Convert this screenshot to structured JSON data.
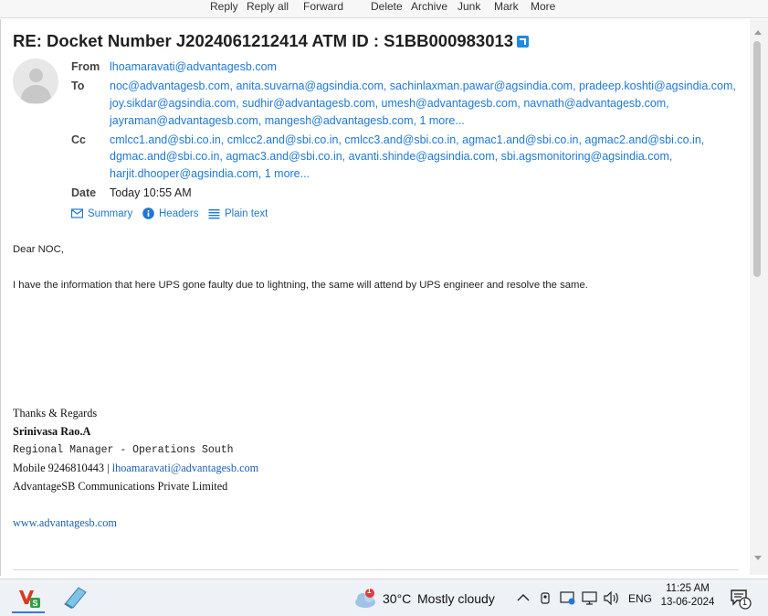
{
  "toolbar": {
    "reply": "Reply",
    "reply_all": "Reply all",
    "forward": "Forward",
    "delete": "Delete",
    "archive": "Archive",
    "junk": "Junk",
    "mark": "Mark",
    "more": "More"
  },
  "message": {
    "subject": "RE: Docket Number J2024061212414 ATM ID : S1BB000983013",
    "from_label": "From",
    "from": "lhoamaravati@advantagesb.com",
    "to_label": "To",
    "to_lines": [
      "noc@advantagesb.com, anita.suvarna@agsindia.com, sachinlaxman.pawar@agsindia.com, pradeep.koshti@agsindia.com,",
      "joy.sikdar@agsindia.com, sudhir@advantagesb.com, umesh@advantagesb.com, navnath@advantagesb.com,",
      "jayraman@advantagesb.com, mangesh@advantagesb.com, 1 more..."
    ],
    "cc_label": "Cc",
    "cc_lines": [
      "cmlcc1.and@sbi.co.in, cmlcc2.and@sbi.co.in, cmlcc3.and@sbi.co.in, agmac1.and@sbi.co.in, agmac2.and@sbi.co.in,",
      "dgmac.and@sbi.co.in, agmac3.and@sbi.co.in, avanti.shinde@agsindia.com, sbi.agsmonitoring@agsindia.com,",
      "harjit.dhooper@agsindia.com, 1 more..."
    ],
    "date_label": "Date",
    "date": "Today 10:55 AM",
    "views": {
      "summary": "Summary",
      "headers": "Headers",
      "plain_text": "Plain text"
    },
    "body": {
      "greeting": "Dear NOC,",
      "paragraph": "I have the information that here  UPS gone faulty due to lightning, the same will attend by UPS engineer and resolve the same."
    },
    "signature": {
      "thanks": "Thanks & Regards",
      "name": "Srinivasa Rao.A",
      "title": "Regional Manager - Operations South",
      "mobile": "Mobile 9246810443 |",
      "email": "lhoamaravati@advantagesb.com",
      "company": "AdvantageSB Communications Private Limited",
      "website": "www.advantagesb.com"
    }
  },
  "taskbar": {
    "weather_badge": "1",
    "temperature": "30°C",
    "weather": "Mostly cloudy",
    "language": "ENG",
    "time": "11:25 AM",
    "date": "13-06-2024",
    "notification_count": "1"
  },
  "colors": {
    "link": "#1e78d4",
    "accent": "#1e88e5",
    "taskbar": "#eef1f5"
  }
}
